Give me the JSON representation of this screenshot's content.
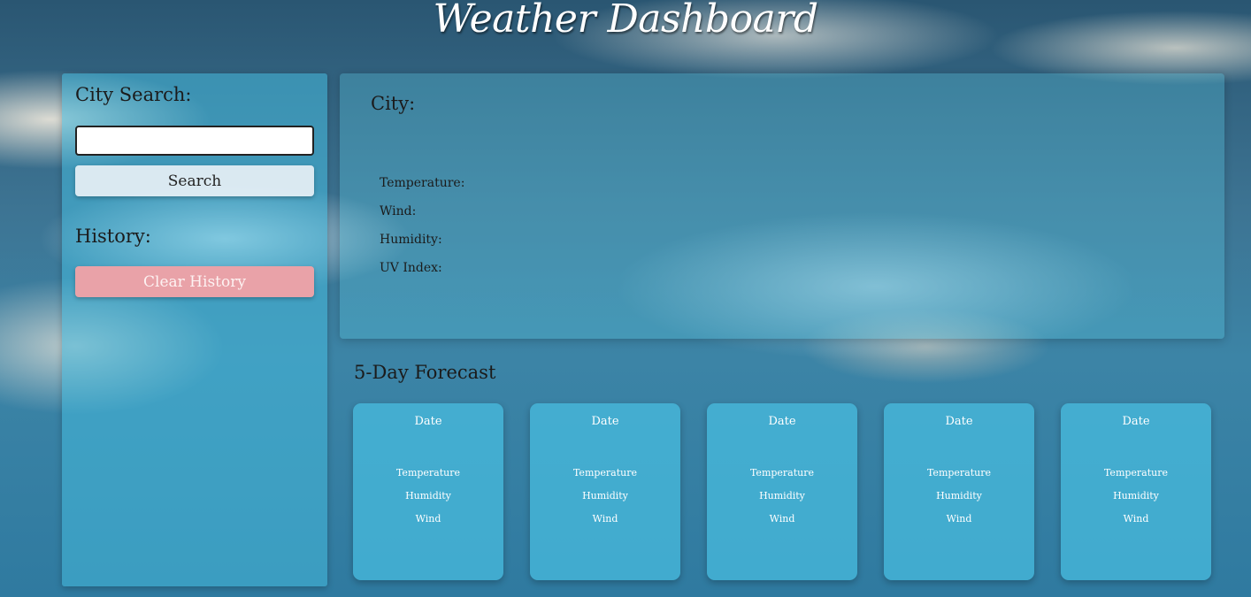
{
  "header": {
    "title": "Weather Dashboard"
  },
  "sidebar": {
    "search_heading": "City Search:",
    "search_input_value": "",
    "search_button": "Search",
    "history_heading": "History:",
    "clear_button": "Clear History"
  },
  "current": {
    "city_label": "City:",
    "temperature_label": "Temperature:",
    "wind_label": "Wind:",
    "humidity_label": "Humidity:",
    "uv_label": "UV Index:"
  },
  "forecast": {
    "heading": "5-Day Forecast",
    "cards": [
      {
        "date": "Date",
        "temperature": "Temperature",
        "humidity": "Humidity",
        "wind": "Wind"
      },
      {
        "date": "Date",
        "temperature": "Temperature",
        "humidity": "Humidity",
        "wind": "Wind"
      },
      {
        "date": "Date",
        "temperature": "Temperature",
        "humidity": "Humidity",
        "wind": "Wind"
      },
      {
        "date": "Date",
        "temperature": "Temperature",
        "humidity": "Humidity",
        "wind": "Wind"
      },
      {
        "date": "Date",
        "temperature": "Temperature",
        "humidity": "Humidity",
        "wind": "Wind"
      }
    ]
  },
  "colors": {
    "clear_button": "#e9a2a8",
    "panel": "#46b9dc",
    "card": "#48bee1"
  }
}
